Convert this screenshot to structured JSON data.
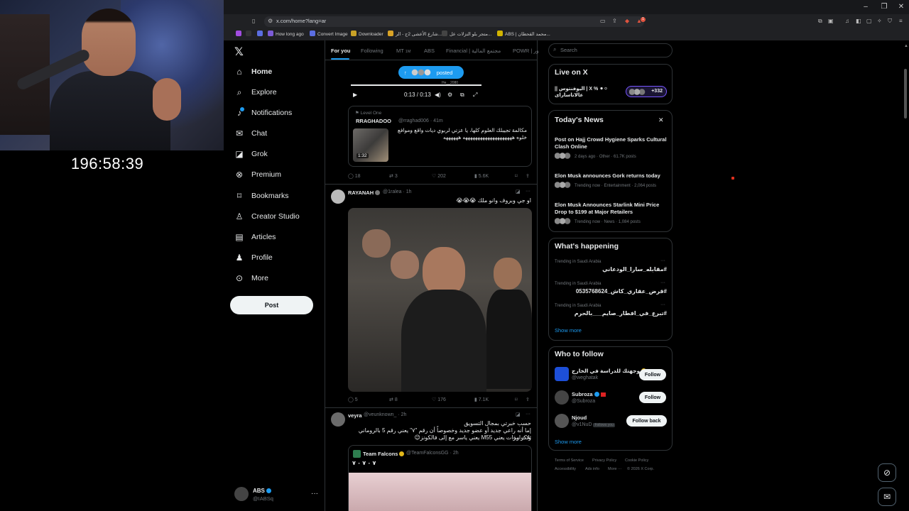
{
  "overlay": {
    "timer": "196:58:39"
  },
  "browser": {
    "url": "x.com/home?lang=ar",
    "bookmarks": [
      {
        "label": "How long ago",
        "color": "#7c5cd6"
      },
      {
        "label": "Convert Image",
        "color": "#5b6ee1"
      },
      {
        "label": "Downloader",
        "color": "#c9a227"
      },
      {
        "label": "شارع الأعشى 2ج - الر...",
        "color": "#d9a326"
      },
      {
        "label": "متجر بلو النزلات عل...",
        "color": "#444"
      },
      {
        "label": "ABS | محمد القحطان...",
        "color": "#d2b400"
      }
    ],
    "notification_count": "1"
  },
  "sidebar": {
    "items": [
      {
        "label": "Home",
        "icon": "home-icon",
        "glyph": "⌂"
      },
      {
        "label": "Explore",
        "icon": "search-icon",
        "glyph": "⌕"
      },
      {
        "label": "Notifications",
        "icon": "bell-icon",
        "glyph": "🔔"
      },
      {
        "label": "Chat",
        "icon": "mail-icon",
        "glyph": "✉"
      },
      {
        "label": "Grok",
        "icon": "grok-icon",
        "glyph": "◪"
      },
      {
        "label": "Premium",
        "icon": "x-premium-icon",
        "glyph": "⊗"
      },
      {
        "label": "Bookmarks",
        "icon": "bookmark-icon",
        "glyph": "⌑"
      },
      {
        "label": "Creator Studio",
        "icon": "creator-studio-icon",
        "glyph": "♙"
      },
      {
        "label": "Articles",
        "icon": "articles-icon",
        "glyph": "▤"
      },
      {
        "label": "Profile",
        "icon": "profile-icon",
        "glyph": "♟"
      },
      {
        "label": "More",
        "icon": "more-circle-icon",
        "glyph": "⊙"
      }
    ],
    "post_label": "Post",
    "account": {
      "name": "ABS",
      "handle": "@IABSq"
    }
  },
  "timeline": {
    "tabs": [
      "For you",
      "Following",
      "MT",
      "ABS",
      "Financial | مجتمع المالية",
      "POWR | ور"
    ],
    "mt_badge": "1M",
    "video": {
      "pill_label": "posted",
      "time": "0:13 / 0:13",
      "progress": 1.0,
      "overlay_text": "He__2080"
    },
    "quote1": {
      "level": "Level One",
      "name": "RRAGHADOO",
      "meta": "@rraghad006 · 41m",
      "text": "مكالمة تجيبلك العلوم كلها، يا عزتي لربوي ديات واقع وموافع خلوه ههههههههههههههههههههه ههههههه",
      "duration": "1:32"
    },
    "actions1": {
      "replies": "18",
      "reposts": "3",
      "likes": "202",
      "views": "5.6K"
    },
    "tweet2": {
      "name": "RAYANAH",
      "meta": "@1ralea · 1h",
      "text": "او جي وبروف وانو ملك 😭😭😭"
    },
    "actions2": {
      "replies": "5",
      "reposts": "8",
      "likes": "176",
      "views": "7.1K"
    },
    "tweet3": {
      "name": "veyra",
      "meta": "@veunknown_ · 2h",
      "line1": "حسب خبرتي بمجال التسويق",
      "line2": "إما أنه راعي جديد أو عضو جديد وخصوصاً أن رقم \"٧\" يعني رقم 5 بالروماني وتكرارة",
      "line3": "ثلاث مرات يعني M55 يعني ياسر مع إلى فالكونز😉"
    },
    "quote3": {
      "name": "Team Falcons",
      "meta": "@TeamFalconsGG · 2h",
      "text": "٧ ٠ ٧ ٠ ٧"
    }
  },
  "right": {
    "search_placeholder": "Search",
    "live": {
      "title": "Live on X",
      "text": "⚪⚫ % X | اليوفنتوس || عالاتاسارای",
      "count": "+332"
    },
    "news": {
      "title": "Today's News",
      "items": [
        {
          "title": "Post on Hajj Crowd Hygiene Sparks Cultural Clash Online",
          "meta": "2 days ago · Other · 61.7K posts"
        },
        {
          "title": "Elon Musk announces Gork returns today",
          "meta": "Trending now · Entertainment · 2,064 posts"
        },
        {
          "title": "Elon Musk Announces Starlink Mini Price Drop to $199 at Major Retailers",
          "meta": "Trending now · News · 1,084 posts"
        }
      ]
    },
    "happening": {
      "title": "What's happening",
      "items": [
        {
          "meta": "Trending in Saudi Arabia",
          "tag": "#مقابله_سارا_الودعاني"
        },
        {
          "meta": "Trending in Saudi Arabia",
          "tag": "#قرض_عقاري_كاش_0535768624"
        },
        {
          "meta": "Trending in Saudi Arabia",
          "tag": "#تبرع_في_افطار_صايم___بالحرم"
        }
      ],
      "show_more": "Show more"
    },
    "who": {
      "title": "Who to follow",
      "items": [
        {
          "name": "وجهتك للدراسة في الخارج",
          "handle": "@weghatak",
          "button": "Follow",
          "color": "#1d4fd8"
        },
        {
          "name": "Subroza",
          "handle": "@Subroza",
          "button": "Follow",
          "color": "#444"
        },
        {
          "name": "Njoud",
          "handle": "@v1NuD",
          "button": "Follow back",
          "color": "#555",
          "badge": "Follows you"
        }
      ],
      "show_more": "Show more"
    },
    "footer": [
      "Terms of Service",
      "Privacy Policy",
      "Cookie Policy",
      "Accessibility",
      "Ads info",
      "More ···",
      "© 2026 X Corp."
    ]
  }
}
